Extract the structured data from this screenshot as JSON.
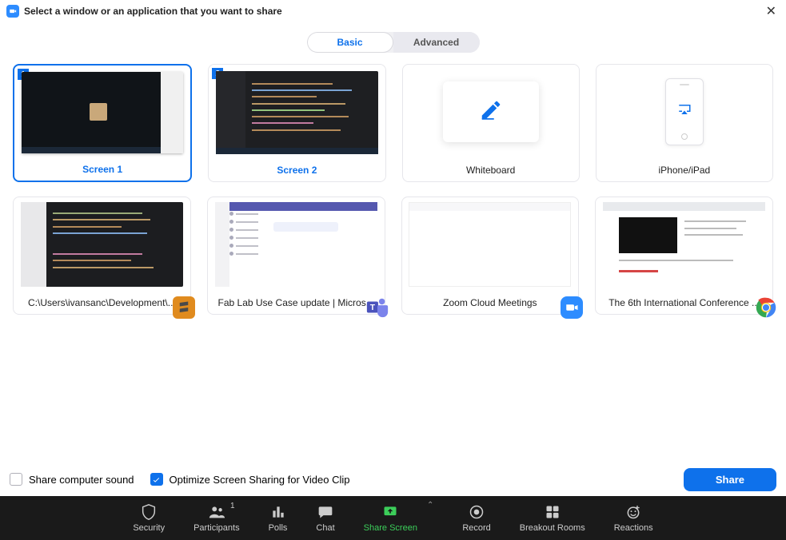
{
  "window": {
    "title": "Select a window or an application that you want to share"
  },
  "tabs": {
    "basic": "Basic",
    "advanced": "Advanced"
  },
  "tiles": {
    "screen1": {
      "label": "Screen 1",
      "badge": "1"
    },
    "screen2": {
      "label": "Screen 2",
      "badge": "2"
    },
    "whiteboard": {
      "label": "Whiteboard"
    },
    "iphone": {
      "label": "iPhone/iPad"
    },
    "app_sublime": {
      "label": "C:\\Users\\ivansanc\\Development\\..."
    },
    "app_teams": {
      "label": "Fab Lab Use Case update | Micros..."
    },
    "app_zoom": {
      "label": "Zoom Cloud Meetings"
    },
    "app_chrome": {
      "label": "The 6th International Conference ..."
    }
  },
  "options": {
    "share_sound": "Share computer sound",
    "optimize_video": "Optimize Screen Sharing for Video Clip"
  },
  "buttons": {
    "share": "Share"
  },
  "toolbar": {
    "security": "Security",
    "participants": "Participants",
    "participants_count": "1",
    "polls": "Polls",
    "chat": "Chat",
    "share_screen": "Share Screen",
    "record": "Record",
    "breakout": "Breakout Rooms",
    "reactions": "Reactions"
  }
}
